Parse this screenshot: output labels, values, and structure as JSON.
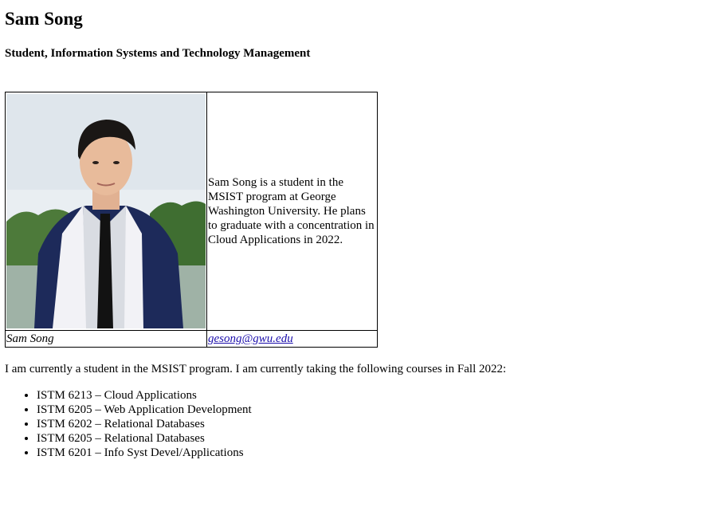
{
  "profile": {
    "name": "Sam Song",
    "subtitle": "Student, Information Systems and Technology Management",
    "photo_caption": "Sam Song",
    "bio": "Sam Song is a student in the MSIST program at George Washington University. He plans to graduate with a concentration in Cloud Applications in 2022.",
    "email": "gesong@gwu.edu"
  },
  "intro": "I am currently a student in the MSIST program. I am currently taking the following courses in Fall 2022:",
  "courses": [
    "ISTM 6213 – Cloud Applications",
    "ISTM 6205 – Web Application Development",
    "ISTM 6202 – Relational Databases",
    "ISTM 6205 – Relational Databases",
    "ISTM 6201 – Info Syst Devel/Applications"
  ],
  "colors": {
    "link": "#1a0dab",
    "gown": "#1d2a5a",
    "stole": "#f2f2f6"
  }
}
